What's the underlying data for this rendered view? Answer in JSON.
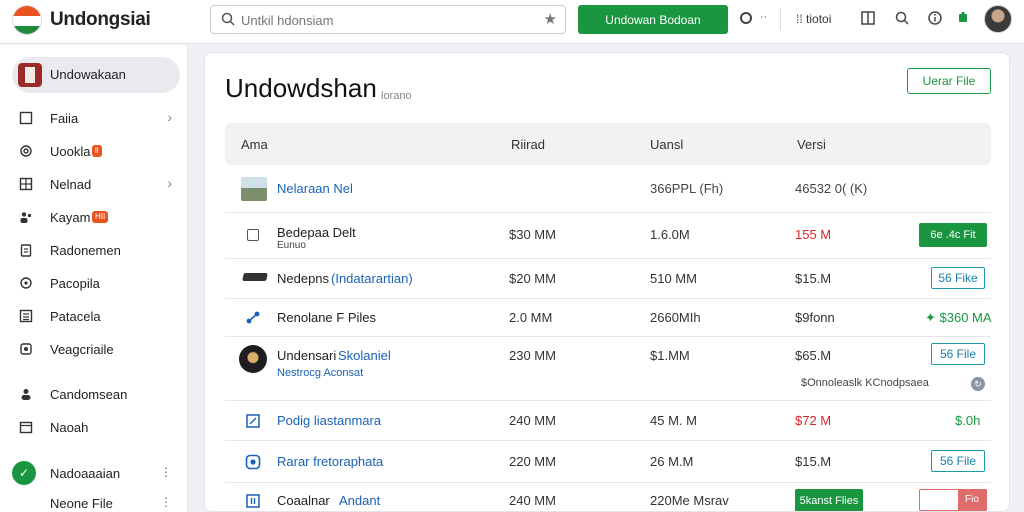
{
  "app": {
    "title": "Undongsiai"
  },
  "search": {
    "placeholder": "Untkil hdonsiam"
  },
  "toolbar": {
    "primary_button": "Undowan Bodoan",
    "dots": "··",
    "tools_label": "tiotoi"
  },
  "sidebar": {
    "items": [
      {
        "label": "Undowakaan",
        "icon": "flag-avatar-icon",
        "active": true
      },
      {
        "label": "Faiia",
        "icon": "square-icon",
        "chevron": true
      },
      {
        "label": "Uookla",
        "icon": "at-icon",
        "badge": "ll"
      },
      {
        "label": "Nelnad",
        "icon": "grid-icon",
        "chevron": true
      },
      {
        "label": "Kayam",
        "icon": "people-icon",
        "badge": "HII"
      },
      {
        "label": "Radonemen",
        "icon": "clipboard-icon"
      },
      {
        "label": "Pacopila",
        "icon": "circle-icon"
      },
      {
        "label": "Patacela",
        "icon": "list-icon"
      },
      {
        "label": "Veagcriaile",
        "icon": "settings-icon"
      },
      {
        "label": "Candomsean",
        "icon": "person-icon"
      },
      {
        "label": "Naoah",
        "icon": "calendar-icon"
      },
      {
        "label": "Nadoaaaian",
        "icon": "green-badge-icon"
      },
      {
        "label": "Neone File",
        "icon": "none"
      }
    ]
  },
  "main": {
    "title": "Undowdshan",
    "subtitle": "lorano",
    "header_button": "Uerar File",
    "columns": [
      "Ama",
      "Riirad",
      "Uansl",
      "Versi"
    ],
    "rows": [
      {
        "name": "Nelaraan Nel",
        "name_style": "link",
        "c2": "",
        "c3": "366PPL (Fh)",
        "c4": "46532 0( (K)",
        "c4_style": "muted",
        "action": "",
        "action_style": "none",
        "leading": "thumbnail"
      },
      {
        "name": "Bedepaa Delt",
        "sub": "Eunuo",
        "name_style": "text",
        "c2": "$30 MM",
        "c3": "1.6.0M",
        "c4": "155 M",
        "c4_style": "red",
        "action": "6e .4c Fit",
        "action_style": "solid",
        "leading": "checkbox"
      },
      {
        "name": "Nedepns",
        "name_link": "(Indatarartian)",
        "name_style": "mixed",
        "c2": "$20 MM",
        "c3": "510 MM",
        "c4": "$15.M",
        "c4_style": "muted",
        "action": "56 Fike",
        "action_style": "outline",
        "leading": "bar"
      },
      {
        "name": "Renolane F Piles",
        "name_style": "text",
        "c2": "2.0 MM",
        "c3": "2660MIh",
        "c4": "$9fonn",
        "c4_style": "muted",
        "action": "✦ $360 MA",
        "action_style": "green-text",
        "leading": "share"
      },
      {
        "name": "Undensari",
        "name_link": "Skolaniel",
        "sub": "Nestrocg Aconsat",
        "name_style": "mixed",
        "c2": "230 MM",
        "c3": "$1.MM",
        "c4": "$65.M",
        "c4_style": "muted",
        "action": "56 File",
        "action_style": "outline",
        "note": "$Onnoleaslk KCnodpsaea",
        "leading": "avatar"
      },
      {
        "name": "Podig liastanmara",
        "name_style": "link",
        "c2": "240 MM",
        "c3": "45 M. M",
        "c4": "$72 M",
        "c4_style": "red",
        "action": "$.0h",
        "action_style": "green-text",
        "leading": "doc"
      },
      {
        "name": "Rarar fretoraphata",
        "name_style": "link",
        "c2": "220 MM",
        "c3": "26 M.M",
        "c4": "$15.M",
        "c4_style": "muted",
        "action": "56 File",
        "action_style": "outline",
        "leading": "round"
      },
      {
        "name": "Coaalnar",
        "name_link": "Andant",
        "name_style": "mixed",
        "c2": "240 MM",
        "c3": "220Me Msrav",
        "c4": "",
        "c4_style": "muted",
        "action": "5kanst Flies",
        "action_style": "solid",
        "action2": "Fio",
        "leading": "square"
      }
    ]
  },
  "colors": {
    "accent_green": "#1a9641",
    "link_blue": "#1a62b8",
    "danger_red": "#d92626"
  }
}
